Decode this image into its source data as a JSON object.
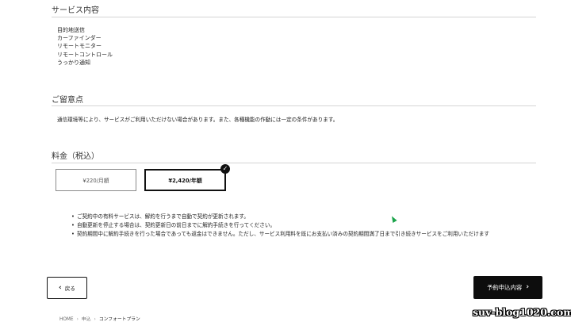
{
  "service": {
    "title": "サービス内容",
    "items": [
      "目的地送信",
      "カーファインダー",
      "リモートモニター",
      "リモートコントロール",
      "うっかり通知"
    ]
  },
  "notes": {
    "title": "ご留意点",
    "text": "通信環境等により、サービスがご利用いただけない場合があります。また、各種機能の作動には一定の条件があります。"
  },
  "pricing": {
    "title": "料金（税込）",
    "monthly_label": "¥220/月額",
    "yearly_label": "¥2,420/年額",
    "selected": "yearly",
    "check_glyph": "✓"
  },
  "bullets": [
    "ご契約中の有料サービスは、解約を行うまで自動で契約が更新されます。",
    "自動更新を停止する場合は、契約更新日の前日までに解約手続きを行ってください。",
    "契約期間中に解約手続きを行った場合であっても返金はできません。ただし、サービス利用料を既にお支払い済みの契約期間満了日まで引き続きサービスをご利用いただけます"
  ],
  "nav": {
    "back_label": "戻る",
    "next_label": "予約申込内容",
    "back_glyph": "‹",
    "next_glyph": "›"
  },
  "breadcrumb": {
    "home": "HOME",
    "apply": "申込",
    "current": "コンフォートプラン",
    "sep": "›"
  },
  "watermark": "suv-blog1020.com"
}
